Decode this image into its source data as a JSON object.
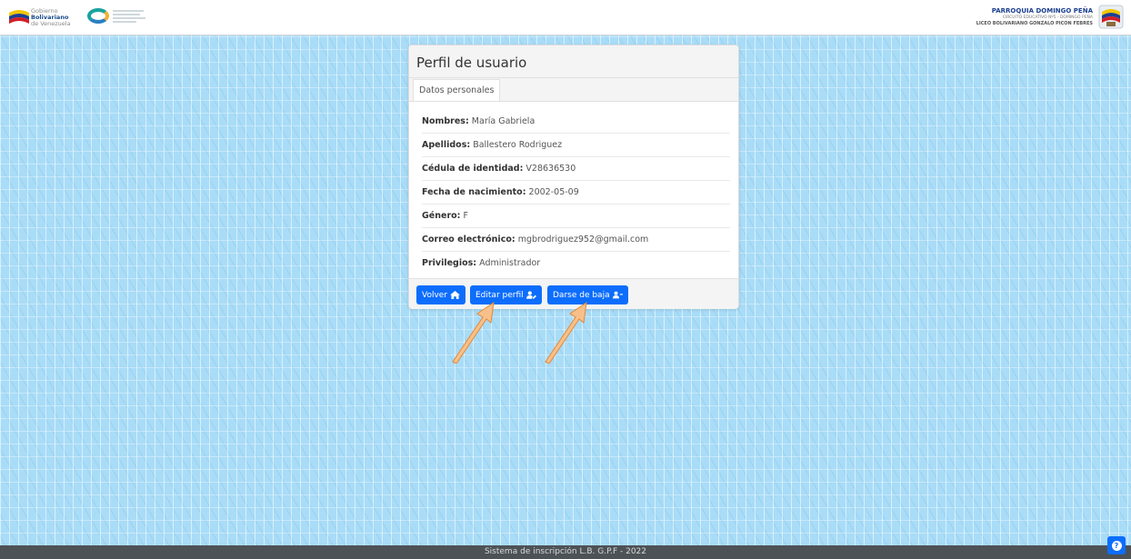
{
  "header": {
    "gobierno_lines": [
      "Gobierno",
      "Bolivariano",
      "de Venezuela"
    ],
    "parroquia_title": "PARROQUIA DOMINGO PEÑA",
    "parroquia_sub": "CIRCUITO EDUCATIVO Nº5 - DOMINGO PEÑA",
    "liceo_name": "LICEO BOLIVARIANO GONZALO PICON FEBRES"
  },
  "card": {
    "title": "Perfil de usuario",
    "tab_label": "Datos personales",
    "fields": [
      {
        "label": "Nombres:",
        "value": "María Gabriela"
      },
      {
        "label": "Apellidos:",
        "value": "Ballestero Rodriguez"
      },
      {
        "label": "Cédula de identidad:",
        "value": "V28636530"
      },
      {
        "label": "Fecha de nacimiento:",
        "value": "2002-05-09"
      },
      {
        "label": "Género:",
        "value": "F"
      },
      {
        "label": "Correo electrónico:",
        "value": "mgbrodriguez952@gmail.com"
      },
      {
        "label": "Privilegios:",
        "value": "Administrador"
      }
    ],
    "buttons": {
      "back": "Volver",
      "edit": "Editar perfil",
      "unsubscribe": "Darse de baja"
    }
  },
  "footer": {
    "text": "Sistema de inscripción L.B. G.P.F - 2022"
  },
  "colors": {
    "primary": "#0d6efd",
    "background": "#a9dcf7",
    "footer_bg": "#4d5256",
    "annotation_arrow": "#f7c08a"
  },
  "icons": {
    "back": "home-icon",
    "edit": "user-edit-icon",
    "unsubscribe": "user-minus-icon",
    "help": "question-circle-icon"
  }
}
